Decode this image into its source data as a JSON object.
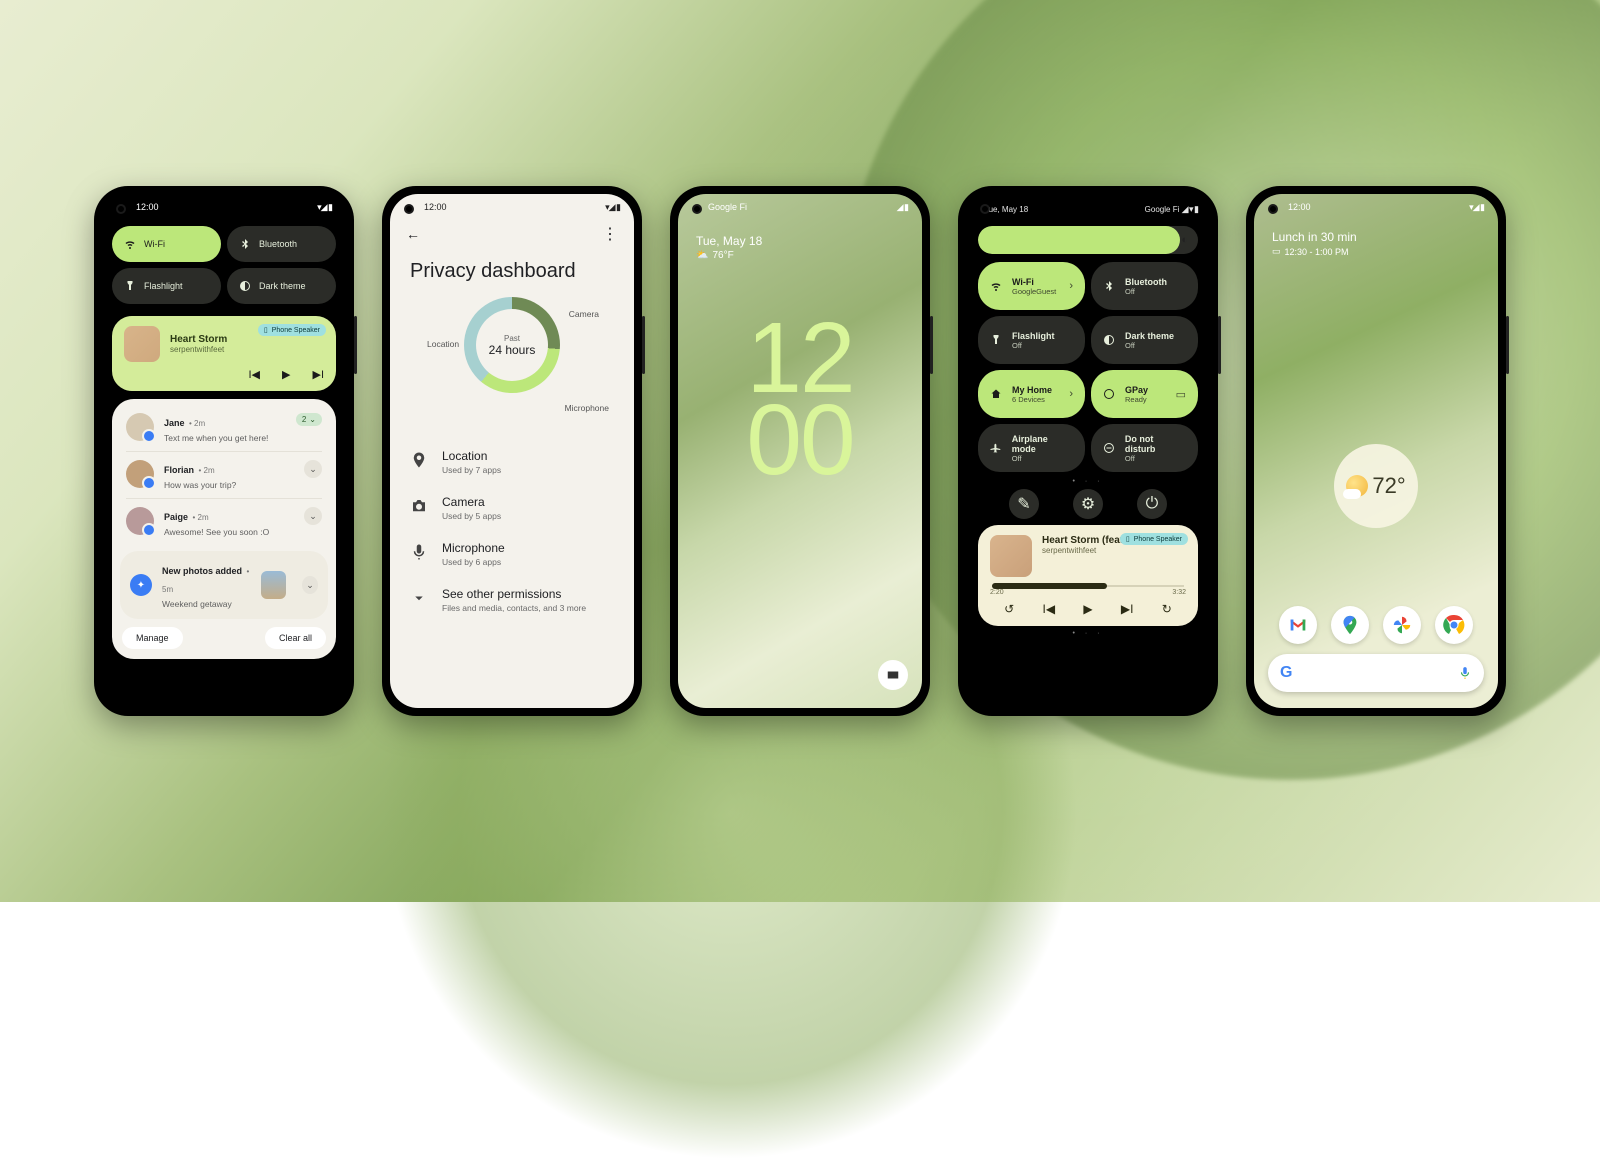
{
  "phone1": {
    "status_time": "12:00",
    "status_icons": "▾◢ ▮",
    "qs": [
      {
        "label": "Wi-Fi",
        "on": true,
        "icon": "wifi"
      },
      {
        "label": "Bluetooth",
        "on": false,
        "icon": "bluetooth"
      },
      {
        "label": "Flashlight",
        "on": false,
        "icon": "flashlight"
      },
      {
        "label": "Dark theme",
        "on": false,
        "icon": "dark"
      }
    ],
    "media": {
      "title": "Heart Storm",
      "artist": "serpentwithfeet",
      "output": "Phone Speaker"
    },
    "convos": [
      {
        "name": "Jane",
        "time": "2m",
        "body": "Text me when you get here!",
        "badge": "2"
      },
      {
        "name": "Florian",
        "time": "2m",
        "body": "How was your trip?"
      },
      {
        "name": "Paige",
        "time": "2m",
        "body": "Awesome! See you soon :O"
      }
    ],
    "photos": {
      "title": "New photos added",
      "time": "5m",
      "sub": "Weekend getaway"
    },
    "manage": "Manage",
    "clear": "Clear all"
  },
  "phone2": {
    "status_time": "12:00",
    "status_icons": "▾◢ ▮",
    "title": "Privacy dashboard",
    "ring_small": "Past",
    "ring_big": "24 hours",
    "ring_labels": {
      "location": "Location",
      "camera": "Camera",
      "microphone": "Microphone"
    },
    "perms": [
      {
        "icon": "location",
        "t": "Location",
        "s": "Used by 7 apps"
      },
      {
        "icon": "camera",
        "t": "Camera",
        "s": "Used by 5 apps"
      },
      {
        "icon": "mic",
        "t": "Microphone",
        "s": "Used by 6 apps"
      },
      {
        "icon": "expand",
        "t": "See other permissions",
        "s": "Files and media, contacts, and 3 more"
      }
    ]
  },
  "phone3": {
    "carrier": "Google Fi",
    "status_icons": "◢ ▮",
    "date": "Tue, May 18",
    "temp": "76°F",
    "clock_top": "12",
    "clock_bot": "00"
  },
  "phone4": {
    "date": "Tue, May 18",
    "carrier": "Google Fi",
    "status_icons": "◢ ▾ ▮",
    "tiles": [
      {
        "t": "Wi-Fi",
        "s": "GoogleGuest",
        "on": true,
        "icon": "wifi",
        "chev": true
      },
      {
        "t": "Bluetooth",
        "s": "Off",
        "on": false,
        "icon": "bluetooth"
      },
      {
        "t": "Flashlight",
        "s": "Off",
        "on": false,
        "icon": "flashlight"
      },
      {
        "t": "Dark theme",
        "s": "Off",
        "on": false,
        "icon": "dark"
      },
      {
        "t": "My Home",
        "s": "6 Devices",
        "on": true,
        "icon": "home",
        "chev": true
      },
      {
        "t": "GPay",
        "s": "Ready",
        "on": true,
        "icon": "gpay",
        "card": true
      },
      {
        "t": "Airplane mode",
        "s": "Off",
        "on": false,
        "icon": "plane"
      },
      {
        "t": "Do not disturb",
        "s": "Off",
        "on": false,
        "icon": "dnd"
      }
    ],
    "player": {
      "title": "Heart Storm (feat. NAO)",
      "artist": "serpentwithfeet",
      "output": "Phone Speaker",
      "elapsed": "2:20",
      "total": "3:32"
    }
  },
  "phone5": {
    "status_time": "12:00",
    "status_icons": "▾◢ ▮",
    "glance_title": "Lunch in 30 min",
    "glance_sub": "12:30 - 1:00 PM",
    "temp": "72°",
    "apps": [
      "gmail",
      "maps",
      "photos",
      "chrome"
    ]
  }
}
